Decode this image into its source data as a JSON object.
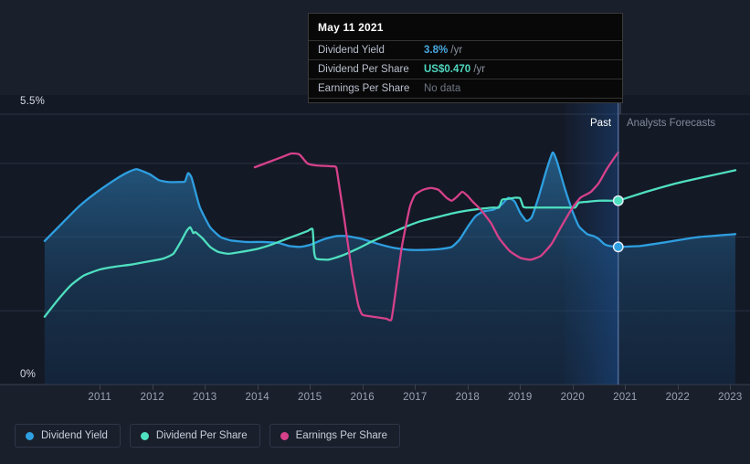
{
  "chart_data": {
    "type": "line",
    "title": "",
    "xlabel": "",
    "ylabel": "",
    "grid": true,
    "ylim": [
      0,
      5.5
    ],
    "y_ticks": [
      "0%",
      "5.5%"
    ],
    "x_ticks": [
      "2011",
      "2012",
      "2013",
      "2014",
      "2015",
      "2016",
      "2017",
      "2018",
      "2019",
      "2020",
      "2021",
      "2022",
      "2023"
    ],
    "xlim": [
      2010.4,
      2023.6
    ],
    "divider_year": 2021.37,
    "segments": {
      "past_label": "Past",
      "forecast_label": "Analysts Forecasts"
    },
    "series": [
      {
        "name": "Dividend Yield",
        "color": "#2e9fe0",
        "unit": "%/yr",
        "filled": true,
        "points": [
          [
            2010.45,
            2.92
          ],
          [
            2010.8,
            3.3
          ],
          [
            2011.1,
            3.62
          ],
          [
            2011.4,
            3.88
          ],
          [
            2011.75,
            4.14
          ],
          [
            2012.0,
            4.3
          ],
          [
            2012.2,
            4.38
          ],
          [
            2012.45,
            4.28
          ],
          [
            2012.62,
            4.16
          ],
          [
            2012.8,
            4.12
          ],
          [
            2013.0,
            4.12
          ],
          [
            2013.12,
            4.13
          ],
          [
            2013.18,
            4.3
          ],
          [
            2013.25,
            4.2
          ],
          [
            2013.4,
            3.62
          ],
          [
            2013.6,
            3.2
          ],
          [
            2013.8,
            3.0
          ],
          [
            2014.0,
            2.93
          ],
          [
            2014.3,
            2.9
          ],
          [
            2014.6,
            2.9
          ],
          [
            2014.9,
            2.88
          ],
          [
            2015.1,
            2.82
          ],
          [
            2015.3,
            2.8
          ],
          [
            2015.5,
            2.84
          ],
          [
            2015.75,
            2.95
          ],
          [
            2016.0,
            3.02
          ],
          [
            2016.2,
            3.02
          ],
          [
            2016.5,
            2.96
          ],
          [
            2016.8,
            2.86
          ],
          [
            2017.1,
            2.78
          ],
          [
            2017.4,
            2.74
          ],
          [
            2017.7,
            2.74
          ],
          [
            2018.0,
            2.76
          ],
          [
            2018.2,
            2.8
          ],
          [
            2018.35,
            2.95
          ],
          [
            2018.5,
            3.2
          ],
          [
            2018.65,
            3.42
          ],
          [
            2018.8,
            3.52
          ],
          [
            2019.0,
            3.56
          ],
          [
            2019.15,
            3.66
          ],
          [
            2019.28,
            3.8
          ],
          [
            2019.4,
            3.72
          ],
          [
            2019.5,
            3.5
          ],
          [
            2019.62,
            3.33
          ],
          [
            2019.72,
            3.4
          ],
          [
            2019.85,
            3.8
          ],
          [
            2020.0,
            4.35
          ],
          [
            2020.12,
            4.72
          ],
          [
            2020.2,
            4.55
          ],
          [
            2020.35,
            4.0
          ],
          [
            2020.5,
            3.52
          ],
          [
            2020.62,
            3.22
          ],
          [
            2020.78,
            3.06
          ],
          [
            2020.9,
            3.02
          ],
          [
            2021.0,
            2.96
          ],
          [
            2021.1,
            2.86
          ],
          [
            2021.2,
            2.82
          ],
          [
            2021.37,
            2.8
          ]
        ],
        "forecast_points": [
          [
            2021.37,
            2.8
          ],
          [
            2021.8,
            2.82
          ],
          [
            2022.3,
            2.9
          ],
          [
            2022.9,
            3.0
          ],
          [
            2023.6,
            3.06
          ]
        ],
        "marker": [
          2021.37,
          2.8
        ]
      },
      {
        "name": "Dividend Per Share",
        "color": "#4fe0c0",
        "unit": "US$/yr",
        "filled": false,
        "points": [
          [
            2010.45,
            1.38
          ],
          [
            2010.7,
            1.72
          ],
          [
            2010.95,
            2.02
          ],
          [
            2011.2,
            2.22
          ],
          [
            2011.5,
            2.34
          ],
          [
            2011.8,
            2.4
          ],
          [
            2012.1,
            2.44
          ],
          [
            2012.4,
            2.5
          ],
          [
            2012.7,
            2.56
          ],
          [
            2012.9,
            2.66
          ],
          [
            2013.05,
            2.92
          ],
          [
            2013.15,
            3.12
          ],
          [
            2013.22,
            3.2
          ],
          [
            2013.28,
            3.08
          ],
          [
            2013.32,
            3.1
          ],
          [
            2013.45,
            2.98
          ],
          [
            2013.6,
            2.8
          ],
          [
            2013.75,
            2.7
          ],
          [
            2013.95,
            2.66
          ],
          [
            2014.2,
            2.7
          ],
          [
            2014.5,
            2.76
          ],
          [
            2014.75,
            2.84
          ],
          [
            2015.0,
            2.94
          ],
          [
            2015.25,
            3.04
          ],
          [
            2015.45,
            3.12
          ],
          [
            2015.55,
            3.16
          ],
          [
            2015.58,
            2.7
          ],
          [
            2015.62,
            2.56
          ],
          [
            2015.85,
            2.54
          ],
          [
            2016.1,
            2.62
          ],
          [
            2016.4,
            2.76
          ],
          [
            2016.7,
            2.92
          ],
          [
            2017.0,
            3.06
          ],
          [
            2017.3,
            3.2
          ],
          [
            2017.6,
            3.32
          ],
          [
            2017.9,
            3.4
          ],
          [
            2018.2,
            3.48
          ],
          [
            2018.5,
            3.54
          ],
          [
            2018.8,
            3.58
          ],
          [
            2019.0,
            3.6
          ],
          [
            2019.1,
            3.6
          ],
          [
            2019.16,
            3.76
          ],
          [
            2019.3,
            3.78
          ],
          [
            2019.4,
            3.8
          ],
          [
            2019.5,
            3.79
          ],
          [
            2019.56,
            3.62
          ],
          [
            2019.62,
            3.6
          ],
          [
            2020.0,
            3.6
          ],
          [
            2020.4,
            3.6
          ],
          [
            2020.55,
            3.6
          ],
          [
            2020.62,
            3.7
          ],
          [
            2020.8,
            3.72
          ],
          [
            2021.0,
            3.74
          ],
          [
            2021.2,
            3.74
          ],
          [
            2021.37,
            3.74
          ]
        ],
        "forecast_points": [
          [
            2021.37,
            3.74
          ],
          [
            2021.9,
            3.92
          ],
          [
            2022.5,
            4.1
          ],
          [
            2023.0,
            4.22
          ],
          [
            2023.6,
            4.36
          ]
        ],
        "marker": [
          2021.37,
          3.74
        ]
      },
      {
        "name": "Earnings Per Share",
        "color": "#d6418a",
        "unit": "US$/yr",
        "filled": false,
        "points": [
          [
            2014.45,
            4.42
          ],
          [
            2014.7,
            4.52
          ],
          [
            2014.95,
            4.62
          ],
          [
            2015.15,
            4.7
          ],
          [
            2015.3,
            4.68
          ],
          [
            2015.45,
            4.5
          ],
          [
            2015.6,
            4.46
          ],
          [
            2015.9,
            4.44
          ],
          [
            2016.0,
            4.42
          ],
          [
            2016.05,
            4.1
          ],
          [
            2016.15,
            3.4
          ],
          [
            2016.3,
            2.3
          ],
          [
            2016.42,
            1.62
          ],
          [
            2016.5,
            1.42
          ],
          [
            2016.7,
            1.38
          ],
          [
            2016.95,
            1.34
          ],
          [
            2017.05,
            1.32
          ],
          [
            2017.12,
            1.8
          ],
          [
            2017.25,
            2.8
          ],
          [
            2017.4,
            3.6
          ],
          [
            2017.5,
            3.86
          ],
          [
            2017.65,
            3.96
          ],
          [
            2017.8,
            4.0
          ],
          [
            2017.95,
            3.96
          ],
          [
            2018.1,
            3.8
          ],
          [
            2018.2,
            3.74
          ],
          [
            2018.3,
            3.82
          ],
          [
            2018.4,
            3.92
          ],
          [
            2018.5,
            3.84
          ],
          [
            2018.6,
            3.72
          ],
          [
            2018.75,
            3.56
          ],
          [
            2018.95,
            3.28
          ],
          [
            2019.1,
            2.98
          ],
          [
            2019.3,
            2.72
          ],
          [
            2019.5,
            2.58
          ],
          [
            2019.7,
            2.54
          ],
          [
            2019.9,
            2.62
          ],
          [
            2020.1,
            2.86
          ],
          [
            2020.3,
            3.24
          ],
          [
            2020.5,
            3.6
          ],
          [
            2020.65,
            3.8
          ],
          [
            2020.75,
            3.86
          ],
          [
            2020.85,
            3.92
          ],
          [
            2021.0,
            4.1
          ],
          [
            2021.15,
            4.38
          ],
          [
            2021.3,
            4.62
          ],
          [
            2021.37,
            4.72
          ]
        ],
        "forecast_points": [],
        "marker": null
      }
    ]
  },
  "tooltip": {
    "date": "May 11 2021",
    "rows": [
      {
        "label": "Dividend Yield",
        "value": "3.8%",
        "unit": "/yr",
        "color": "#4aa8e0",
        "no_data": false
      },
      {
        "label": "Dividend Per Share",
        "value": "US$0.470",
        "unit": "/yr",
        "color": "#4fd8c0",
        "no_data": false
      },
      {
        "label": "Earnings Per Share",
        "value": "No data",
        "unit": "",
        "color": "#6f7784",
        "no_data": true
      }
    ]
  },
  "legend": {
    "items": [
      {
        "label": "Dividend Yield",
        "color": "#2e9fe0"
      },
      {
        "label": "Dividend Per Share",
        "color": "#4fe0c0"
      },
      {
        "label": "Earnings Per Share",
        "color": "#d6418a"
      }
    ]
  }
}
